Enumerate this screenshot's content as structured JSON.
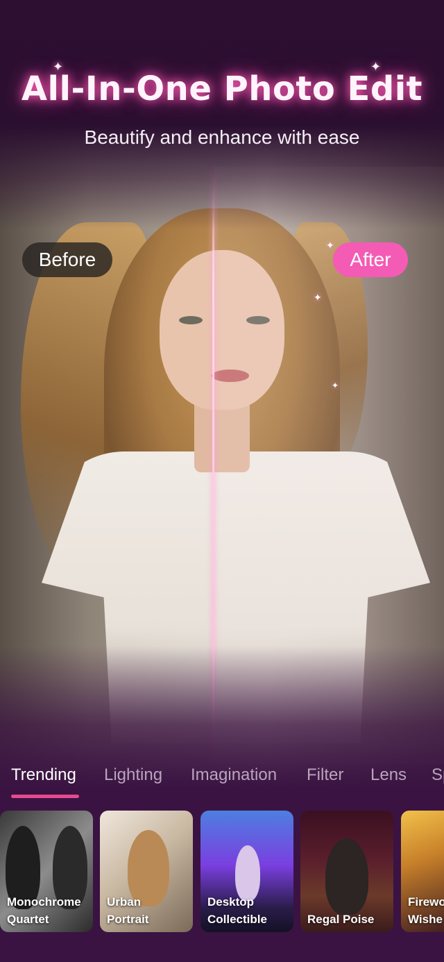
{
  "header": {
    "title": "All-In-One Photo Edit",
    "subtitle": "Beautify and enhance with ease"
  },
  "comparison": {
    "before_label": "Before",
    "after_label": "After"
  },
  "tabs": [
    {
      "label": "Trending",
      "active": true
    },
    {
      "label": "Lighting",
      "active": false
    },
    {
      "label": "Imagination",
      "active": false
    },
    {
      "label": "Filter",
      "active": false
    },
    {
      "label": "Lens",
      "active": false
    },
    {
      "label": "Sp",
      "active": false
    }
  ],
  "cards": [
    {
      "label": "Monochrome\nQuartet"
    },
    {
      "label": "Urban\nPortrait"
    },
    {
      "label": "Desktop\nCollectible"
    },
    {
      "label": "Regal Poise"
    },
    {
      "label": "Firewo\nWishe"
    }
  ],
  "colors": {
    "accent": "#f45bb5",
    "tab_underline": "#e64a8f",
    "background": "#3a1342"
  },
  "icons": [
    "sparkle-icon"
  ]
}
